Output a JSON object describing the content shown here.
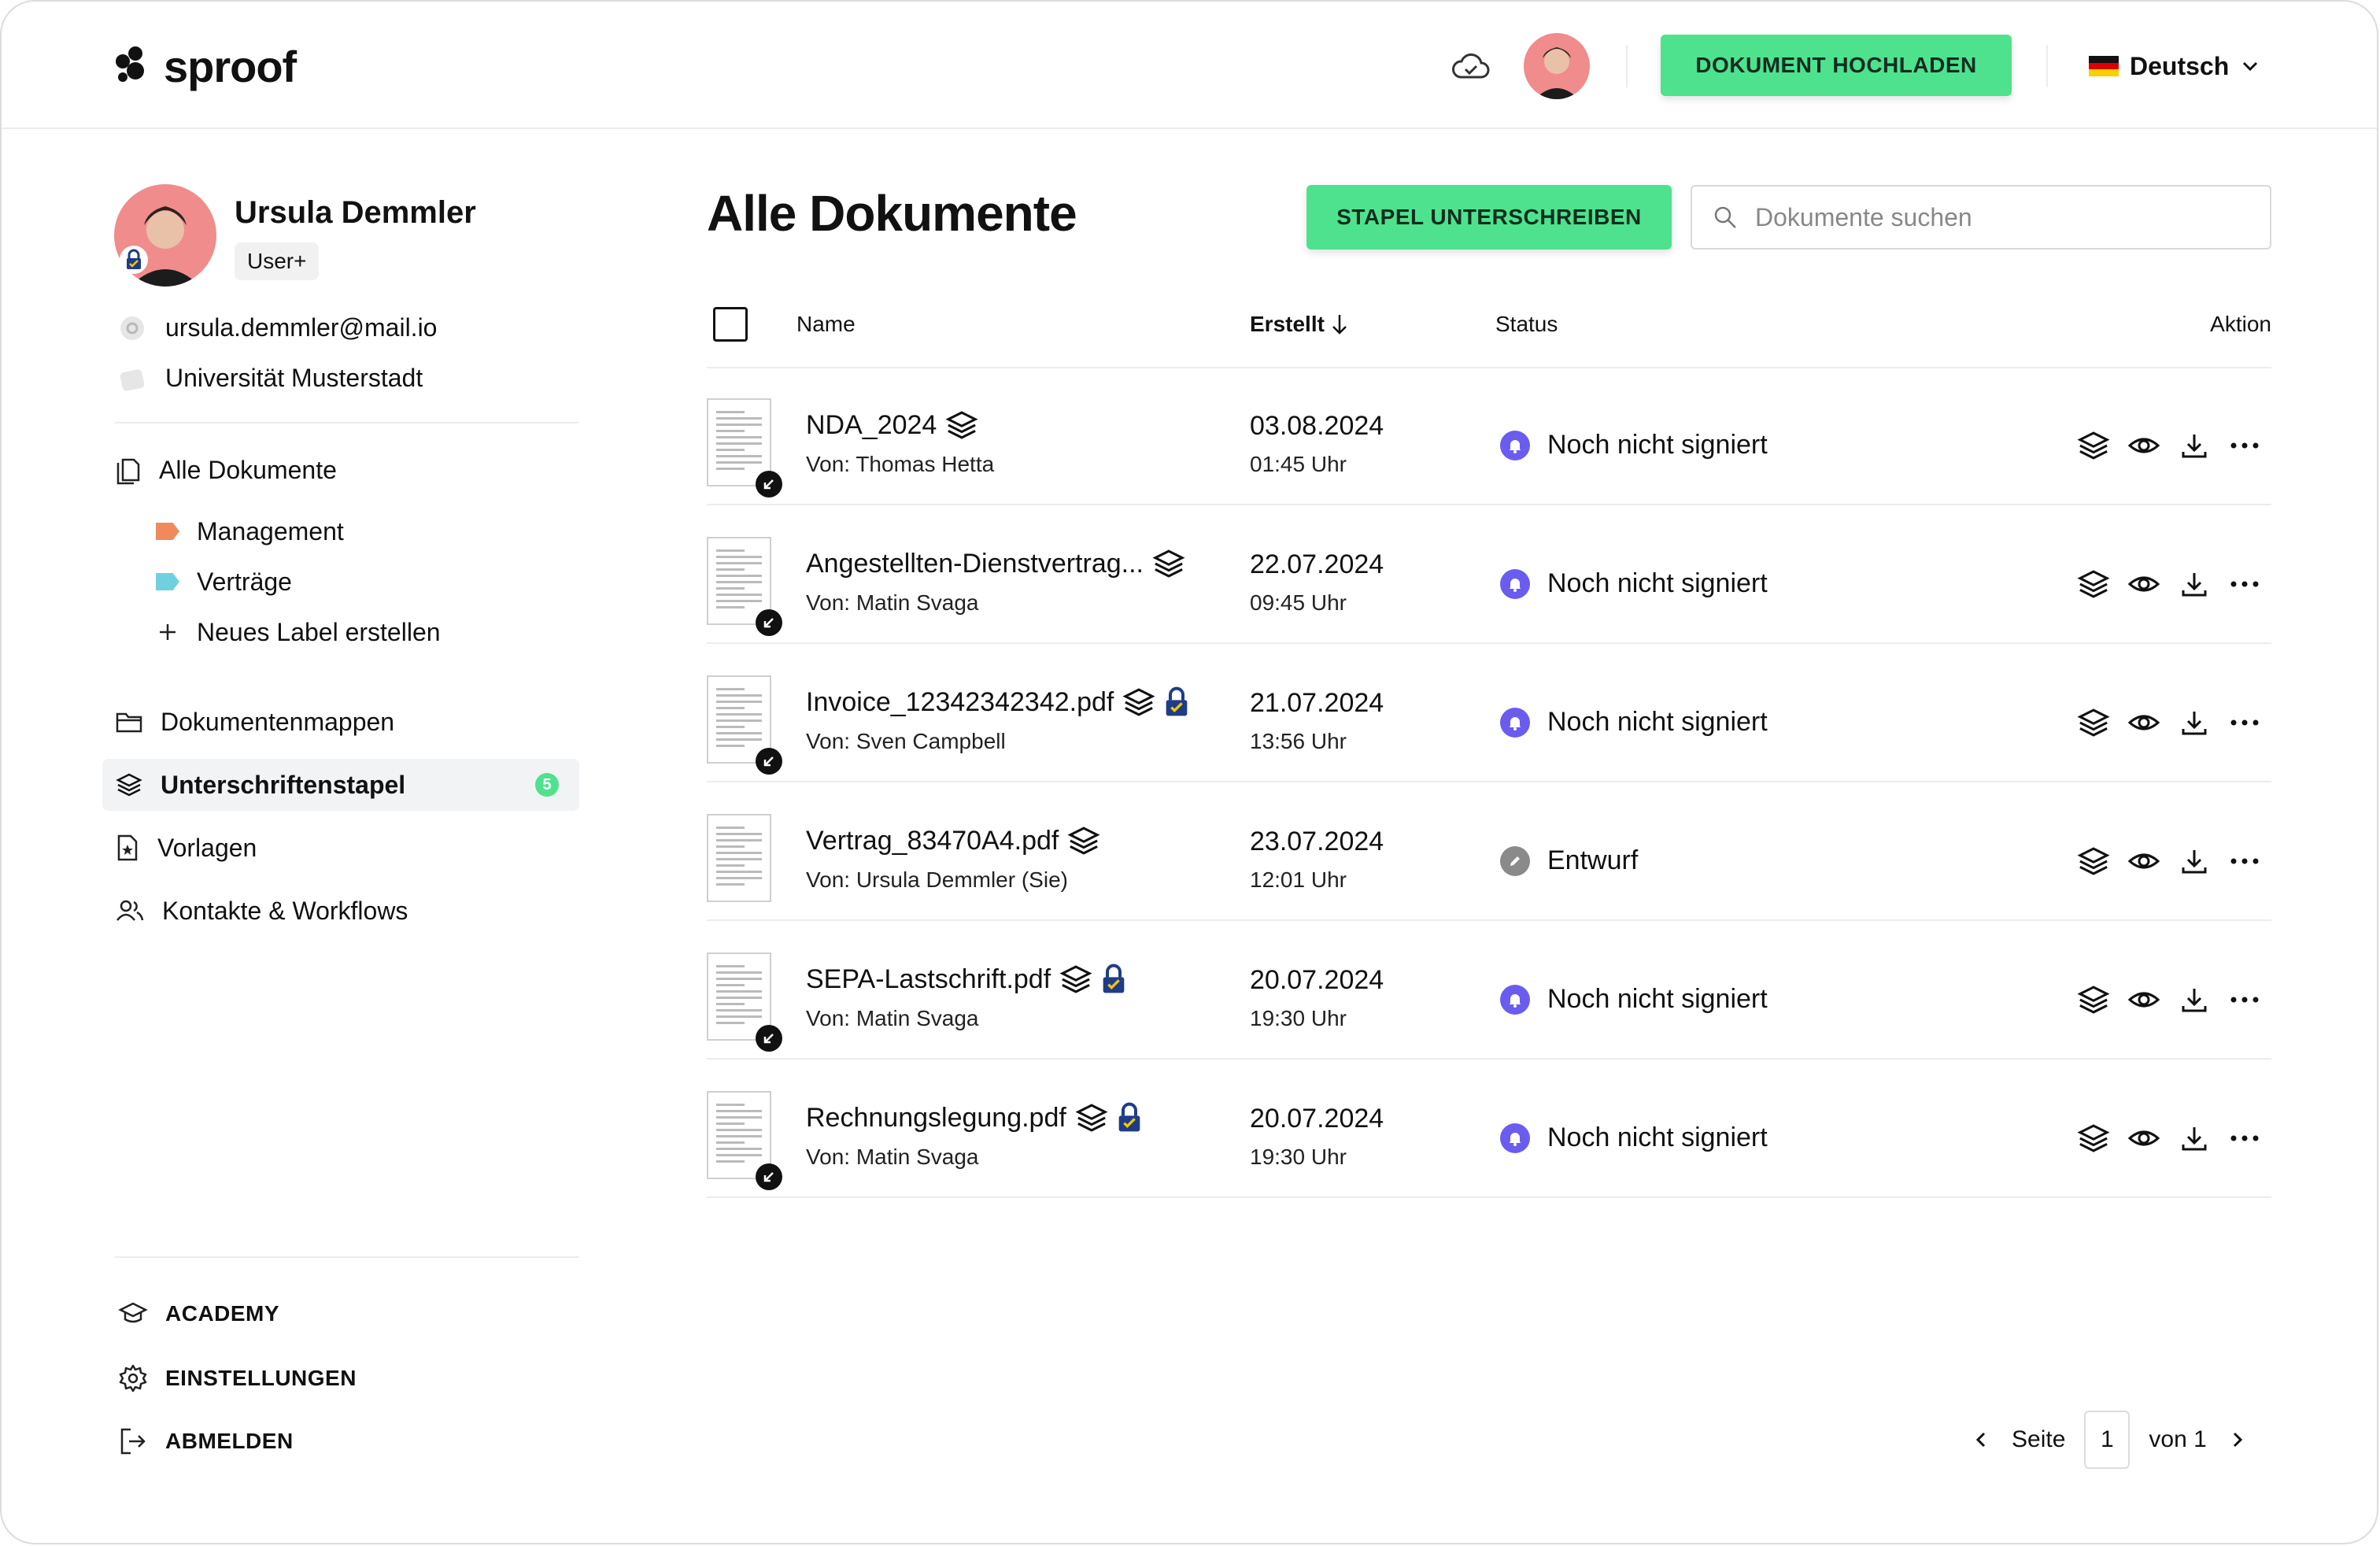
{
  "app": {
    "brand": "sproof",
    "upload_label": "DOKUMENT HOCHLADEN",
    "language": "Deutsch"
  },
  "profile": {
    "name": "Ursula Demmler",
    "role": "User+",
    "email": "ursula.demmler@mail.io",
    "organization": "Universität Musterstadt"
  },
  "sidebar": {
    "all_documents": "Alle Dokumente",
    "labels": [
      {
        "label": "Management",
        "color": "#f08a5d"
      },
      {
        "label": "Verträge",
        "color": "#6fd0e0"
      }
    ],
    "new_label": "Neues Label erstellen",
    "folders": "Dokumentenmappen",
    "batch": "Unterschriftenstapel",
    "batch_count": "5",
    "templates": "Vorlagen",
    "contacts": "Kontakte & Workflows",
    "academy": "ACADEMY",
    "settings": "EINSTELLUNGEN",
    "logout": "ABMELDEN"
  },
  "main": {
    "title": "Alle Dokumente",
    "batch_sign_label": "STAPEL UNTERSCHREIBEN",
    "search_placeholder": "Dokumente suchen",
    "columns": {
      "name": "Name",
      "created": "Erstellt",
      "status": "Status",
      "action": "Aktion"
    },
    "rows": [
      {
        "name": "NDA_2024",
        "from": "Von: Thomas Hetta",
        "date": "03.08.2024",
        "time": "01:45 Uhr",
        "status": "Noch nicht signiert",
        "status_kind": "pending",
        "locked": false,
        "incoming": true
      },
      {
        "name": "Angestellten-Dienstvertrag...",
        "from": "Von: Matin Svaga",
        "date": "22.07.2024",
        "time": "09:45 Uhr",
        "status": "Noch nicht signiert",
        "status_kind": "pending",
        "locked": false,
        "incoming": true
      },
      {
        "name": "Invoice_12342342342.pdf",
        "from": "Von: Sven Campbell",
        "date": "21.07.2024",
        "time": "13:56 Uhr",
        "status": "Noch nicht signiert",
        "status_kind": "pending",
        "locked": true,
        "incoming": true
      },
      {
        "name": "Vertrag_83470A4.pdf",
        "from": "Von: Ursula Demmler (Sie)",
        "date": "23.07.2024",
        "time": "12:01 Uhr",
        "status": "Entwurf",
        "status_kind": "draft",
        "locked": false,
        "incoming": false
      },
      {
        "name": "SEPA-Lastschrift.pdf",
        "from": "Von: Matin Svaga",
        "date": "20.07.2024",
        "time": "19:30 Uhr",
        "status": "Noch nicht signiert",
        "status_kind": "pending",
        "locked": true,
        "incoming": true
      },
      {
        "name": "Rechnungslegung.pdf",
        "from": "Von: Matin Svaga",
        "date": "20.07.2024",
        "time": "19:30 Uhr",
        "status": "Noch nicht signiert",
        "status_kind": "pending",
        "locked": true,
        "incoming": true
      }
    ]
  },
  "pagination": {
    "label": "Seite",
    "current": "1",
    "of": "von 1"
  },
  "colors": {
    "accent_green": "#4ee28f",
    "pending_purple": "#6b5cf0",
    "draft_gray": "#8a8a8a"
  }
}
